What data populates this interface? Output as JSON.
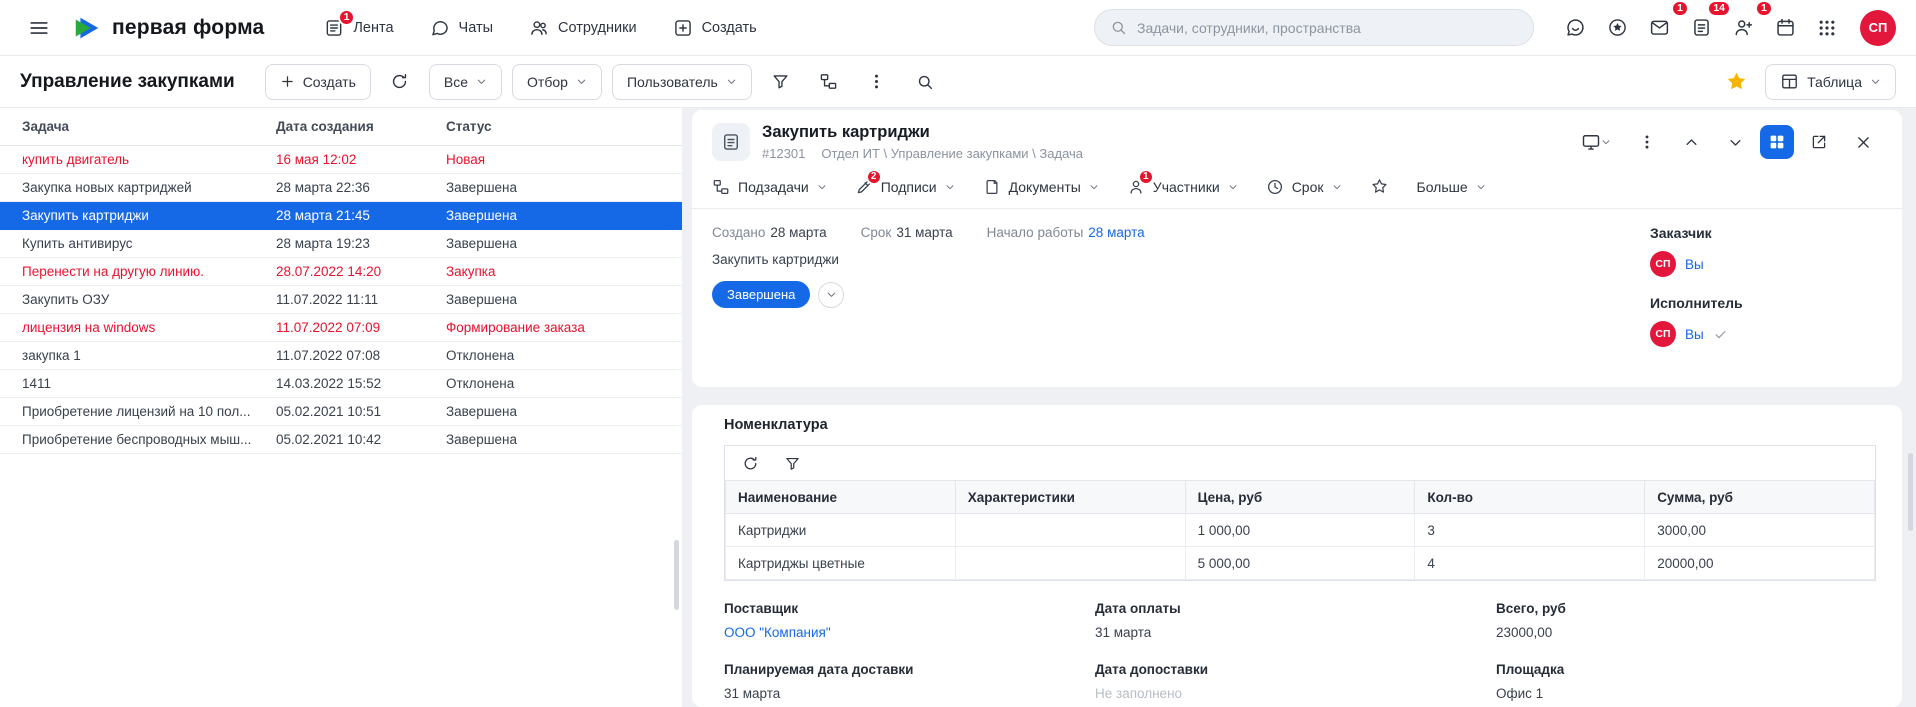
{
  "colors": {
    "accent_blue": "#1569e6",
    "alert_red": "#e8132c",
    "avatar_red": "#e3173b",
    "star_yellow": "#f7b500",
    "logo_green": "#27a93c",
    "logo_blue": "#1569e6"
  },
  "icons": {
    "menu": "hamburger",
    "search": "magnifier",
    "chevron-down": "⌄",
    "kebab": "⋮",
    "close": "✕",
    "check": "✓",
    "favorite-star": "★",
    "filter": "funnel",
    "refresh": "↻"
  },
  "header": {
    "logo_text": "первая форма",
    "nav": [
      {
        "label": "Лента",
        "badge": "1"
      },
      {
        "label": "Чаты"
      },
      {
        "label": "Сотрудники"
      },
      {
        "label": "Создать"
      }
    ],
    "search": {
      "placeholder": "Задачи, сотрудники, пространства",
      "value": ""
    },
    "action_badges": {
      "mail": "1",
      "tasks": "14",
      "invites": "1"
    },
    "avatar_initials": "СП"
  },
  "toolbar": {
    "page_title": "Управление закупками",
    "create_label": "Создать",
    "filter_all": "Все",
    "filter_selection": "Отбор",
    "filter_user": "Пользователь",
    "view_label": "Таблица"
  },
  "task_table": {
    "columns": [
      "Задача",
      "Дата создания",
      "Статус"
    ],
    "rows": [
      {
        "task": "купить двигатель",
        "date": "16 мая 12:02",
        "status": "Новая"
      },
      {
        "task": "Закупка новых картриджей",
        "date": "28 марта 22:36",
        "status": "Завершена"
      },
      {
        "task": "Закупить картриджи",
        "date": "28 марта 21:45",
        "status": "Завершена"
      },
      {
        "task": "Купить антивирус",
        "date": "28 марта 19:23",
        "status": "Завершена"
      },
      {
        "task": "Перенести на другую линию.",
        "date": "28.07.2022 14:20",
        "status": "Закупка"
      },
      {
        "task": "Закупить ОЗУ",
        "date": "11.07.2022 11:11",
        "status": "Завершена"
      },
      {
        "task": "лицензия на windows",
        "date": "11.07.2022 07:09",
        "status": "Формирование заказа"
      },
      {
        "task": "закупка 1",
        "date": "11.07.2022 07:08",
        "status": "Отклонена"
      },
      {
        "task": "1411",
        "date": "14.03.2022 15:52",
        "status": "Отклонена"
      },
      {
        "task": "Приобретение лицензий на 10 пол...",
        "date": "05.02.2021 10:51",
        "status": "Завершена"
      },
      {
        "task": "Приобретение беспроводных мыш...",
        "date": "05.02.2021 10:42",
        "status": "Завершена"
      }
    ]
  },
  "detail": {
    "title": "Закупить картриджи",
    "id": "#12301",
    "breadcrumb": "Отдел ИТ \\ Управление закупками \\ Задача",
    "tabs": [
      {
        "label": "Подзадачи"
      },
      {
        "label": "Подписи",
        "badge": "2"
      },
      {
        "label": "Документы"
      },
      {
        "label": "Участники",
        "badge": "1"
      },
      {
        "label": "Срок"
      },
      {
        "label": "Больше"
      }
    ],
    "meta": {
      "created_label": "Создано",
      "created_value": "28 марта",
      "due_label": "Срок",
      "due_value": "31 марта",
      "start_label": "Начало работы",
      "start_value": "28 марта"
    },
    "description": "Закупить картриджи",
    "status": "Завершена",
    "customer": {
      "label": "Заказчик",
      "name": "Вы",
      "avatar": "СП"
    },
    "executor": {
      "label": "Исполнитель",
      "name": "Вы",
      "avatar": "СП"
    }
  },
  "nomenclature": {
    "title": "Номенклатура",
    "columns": [
      "Наименование",
      "Характеристики",
      "Цена, руб",
      "Кол-во",
      "Сумма, руб"
    ],
    "rows": [
      {
        "name": "Картриджи",
        "specs": "",
        "price": "1 000,00",
        "qty": "3",
        "sum": "3000,00"
      },
      {
        "name": "Картриджы цветные",
        "specs": "",
        "price": "5 000,00",
        "qty": "4",
        "sum": "20000,00"
      }
    ],
    "fields": [
      {
        "label": "Поставщик",
        "value": "ООО \"Компания\""
      },
      {
        "label": "Дата оплаты",
        "value": "31 марта"
      },
      {
        "label": "Всего, руб",
        "value": "23000,00"
      },
      {
        "label": "Планируемая дата доставки",
        "value": "31 марта"
      },
      {
        "label": "Дата допоставки",
        "value": "Не заполнено"
      },
      {
        "label": "Площадка",
        "value": "Офис 1"
      }
    ]
  }
}
